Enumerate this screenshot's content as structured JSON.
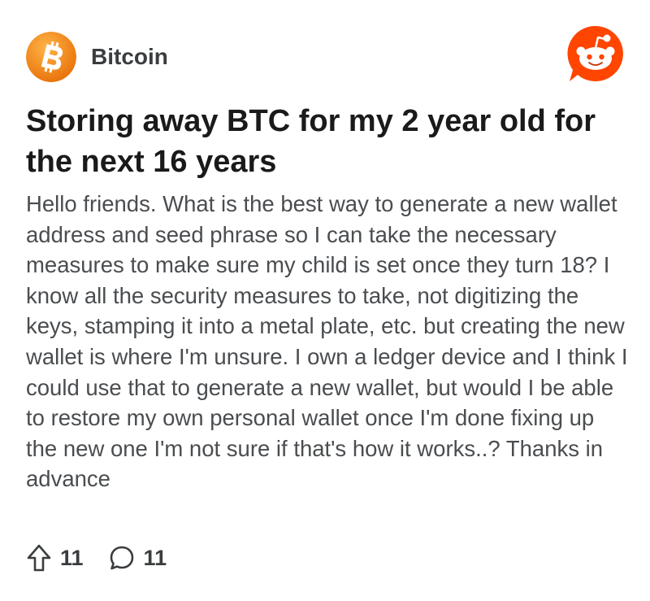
{
  "post": {
    "community": "Bitcoin",
    "community_avatar_icon": "bitcoin-logo-icon",
    "brand_icon": "reddit-logo-icon",
    "title": "Storing away BTC for my 2 year old for the next 16 years",
    "body": "Hello friends. What is the best way to generate a new wallet address and seed phrase so I can take the necessary measures to make sure my child is set once they turn 18? I know all the security measures to take, not digitizing the keys, stamping it into a metal plate, etc. but creating the new wallet is where I'm unsure. I own a ledger device and I think I could use that to generate a new wallet, but would I be able to restore my own personal wallet once I'm done fixing up the new one I'm not sure if that's how it works..? Thanks in advance",
    "upvotes": "11",
    "comments": "11"
  },
  "icons": {
    "upvote": "upvote-arrow-icon",
    "comment": "comment-bubble-icon"
  },
  "colors": {
    "bitcoin_orange": "#f7931a",
    "reddit_orange": "#ff4500",
    "title_text": "#1a1a1b",
    "body_text": "#4a4d50"
  }
}
